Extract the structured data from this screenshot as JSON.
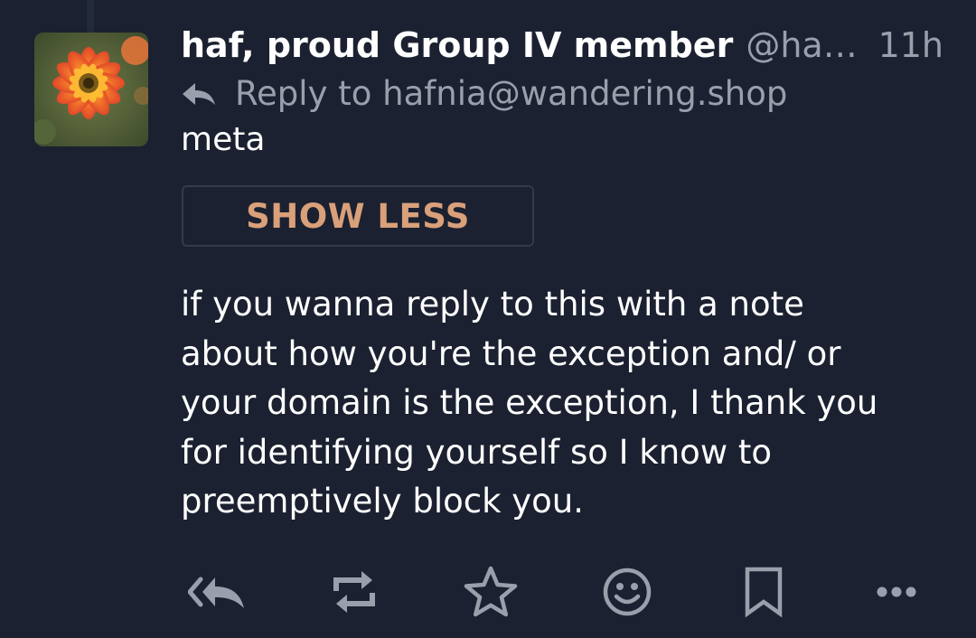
{
  "post": {
    "display_name": "haf, proud Group IV member",
    "handle": "@hafnia@wandering.shop",
    "time": "11h",
    "reply_to": "Reply to hafnia@wandering.shop",
    "content_warning": "meta",
    "show_less_label": "SHOW LESS",
    "content": "if you wanna reply to this with a note about how you're the exception and/ or your domain is the exception, I thank you for identifying yourself so I know to preemptively block you.",
    "avatar_description": "dahlia-flower"
  },
  "actions": [
    {
      "name": "reply-all-button",
      "icon": "reply-all-icon"
    },
    {
      "name": "boost-button",
      "icon": "repeat-icon"
    },
    {
      "name": "favourite-button",
      "icon": "star-icon"
    },
    {
      "name": "react-button",
      "icon": "smiley-icon"
    },
    {
      "name": "bookmark-button",
      "icon": "bookmark-icon"
    },
    {
      "name": "more-button",
      "icon": "more-icon"
    }
  ],
  "colors": {
    "background": "#1b2130",
    "text": "#ffffff",
    "muted": "#9aa0ab",
    "accent": "#d9a07a",
    "button_border": "#333a49"
  }
}
